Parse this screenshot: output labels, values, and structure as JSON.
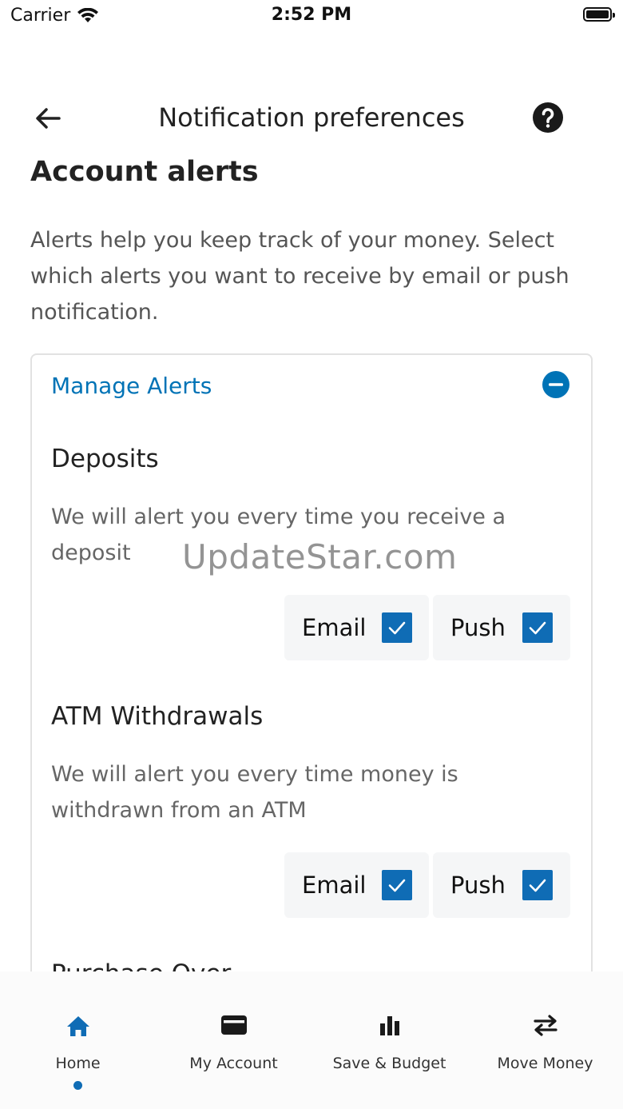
{
  "status_bar": {
    "carrier": "Carrier",
    "time": "2:52 PM"
  },
  "nav": {
    "title": "Notification preferences",
    "back_icon": "arrow-left-icon",
    "help_icon": "question-circle-icon"
  },
  "section": {
    "title": "Account alerts",
    "description": "Alerts help you keep track of your money. Select which alerts you want to receive by email or push notification."
  },
  "manage": {
    "label": "Manage Alerts",
    "icon": "minus-circle-icon",
    "accent": "#0073b6"
  },
  "alerts": [
    {
      "title": "Deposits",
      "description": "We will alert you every time you receive a deposit",
      "email_label": "Email",
      "push_label": "Push",
      "email_checked": true,
      "push_checked": true
    },
    {
      "title": "ATM Withdrawals",
      "description": "We will alert you every time money is withdrawn from an ATM",
      "email_label": "Email",
      "push_label": "Push",
      "email_checked": true,
      "push_checked": true
    },
    {
      "title": "Purchase Over"
    }
  ],
  "watermark": "UpdateStar.com",
  "tabs": [
    {
      "label": "Home",
      "icon": "home-icon",
      "active": true
    },
    {
      "label": "My Account",
      "icon": "card-icon",
      "active": false
    },
    {
      "label": "Save & Budget",
      "icon": "bar-chart-icon",
      "active": false
    },
    {
      "label": "Move Money",
      "icon": "transfer-arrows-icon",
      "active": false
    }
  ],
  "colors": {
    "checkbox": "#0f6cb5",
    "active_tab": "#0f6cb5"
  }
}
